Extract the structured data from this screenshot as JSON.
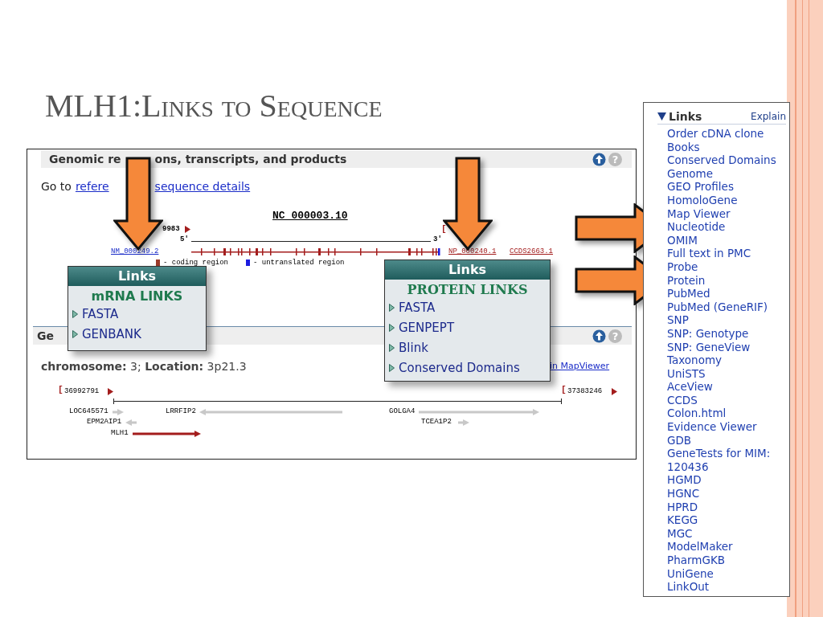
{
  "slide_title": "MLH1:Links to Sequence",
  "gene_panel": {
    "header_parts": [
      "Genomic re",
      "ons, transcripts, and products"
    ],
    "help_label": "?",
    "goto_prefix": "Go to",
    "goto_link_parts": [
      "refere",
      "sequence details"
    ],
    "accession": "NC_000003.10",
    "start_coordinate": "9983",
    "start_bracket": "[",
    "five_prime": "5'",
    "three_prime": "3'",
    "transcript": "NM_000249.2",
    "protein": "NP_000240.1",
    "ccds": "CCDS2663.1",
    "legend": [
      {
        "label": "- coding region",
        "color": "#9c3b2a"
      },
      {
        "label": "- untranslated region",
        "color": "#1c1ce0"
      }
    ]
  },
  "location_panel": {
    "header_fragment": "Ge",
    "help_label": "?",
    "location": "**chromosome:** 3; **Location:** 3p21.3",
    "mapviewer_link": "in MapViewer",
    "range_start": "36992791",
    "range_end": "37383246",
    "genes": [
      {
        "name": "LOC645571",
        "reverse_strand": false,
        "color": "#c8c8c8"
      },
      {
        "name": "LRRFIP2",
        "reverse_strand": true,
        "color": "#c8c8c8"
      },
      {
        "name": "GOLGA4",
        "reverse_strand": false,
        "color": "#c8c8c8"
      },
      {
        "name": "EPM2AIP1",
        "reverse_strand": true,
        "color": "#c8c8c8"
      },
      {
        "name": "TCEA1P2",
        "reverse_strand": false,
        "color": "#c8c8c8"
      },
      {
        "name": "MLH1",
        "reverse_strand": false,
        "color": "#a31d1d"
      }
    ]
  },
  "mrna_popup": {
    "title": "Links",
    "heading": "mRNA LINKS",
    "items": [
      "FASTA",
      "GENBANK"
    ]
  },
  "protein_popup": {
    "title": "Links",
    "heading": "PROTEIN LINKS",
    "items": [
      "FASTA",
      "GENPEPT",
      "Blink",
      "Conserved Domains"
    ]
  },
  "links_panel": {
    "title": "Links",
    "explain": "Explain",
    "items": [
      "Order cDNA clone",
      "Books",
      "Conserved Domains",
      "Genome",
      "GEO Profiles",
      "HomoloGene",
      "Map Viewer",
      "Nucleotide",
      "OMIM",
      "Full text in PMC",
      "Probe",
      "Protein",
      "PubMed",
      "PubMed (GeneRIF)",
      "SNP",
      "SNP: Genotype",
      "SNP: GeneView",
      "Taxonomy",
      "UniSTS",
      "AceView",
      "CCDS",
      "Colon.html",
      "Evidence Viewer",
      "GDB",
      "GeneTests for MIM: 120436",
      "HGMD",
      "HGNC",
      "HPRD",
      "KEGG",
      "MGC",
      "ModelMaker",
      "PharmGKB",
      "UniGene",
      "LinkOut"
    ]
  }
}
